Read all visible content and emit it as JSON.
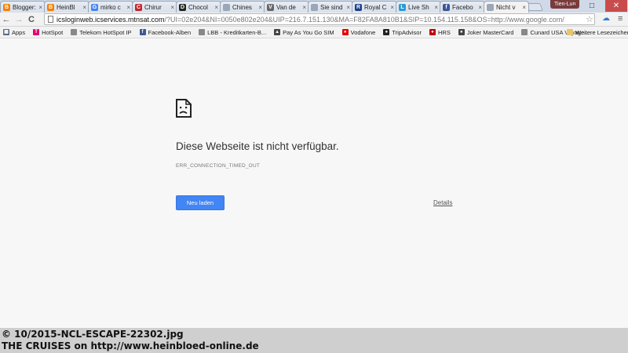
{
  "tabs": [
    {
      "label": "Blogger:",
      "icon": "B",
      "color": "#f57d00"
    },
    {
      "label": "HeinBl",
      "icon": "B",
      "color": "#f57d00"
    },
    {
      "label": "mirko c",
      "icon": "G",
      "color": "#4285f4"
    },
    {
      "label": "Chirur",
      "icon": "C",
      "color": "#c1272d"
    },
    {
      "label": "Chocol",
      "icon": "D",
      "color": "#222222"
    },
    {
      "label": "Chines",
      "icon": "",
      "color": "#9aa7b8"
    },
    {
      "label": "Van de",
      "icon": "V",
      "color": "#666666"
    },
    {
      "label": "Sie sind",
      "icon": "",
      "color": "#9aa7b8"
    },
    {
      "label": "Royal C",
      "icon": "R",
      "color": "#1b3f8b"
    },
    {
      "label": "Live Sh",
      "icon": "L",
      "color": "#2a9ad6"
    },
    {
      "label": "Facebo",
      "icon": "f",
      "color": "#3b5998"
    },
    {
      "label": "Nicht v",
      "icon": "",
      "color": "#9aa7b8"
    }
  ],
  "profile_name": "Tien-Lun",
  "window_controls": {
    "minimize": "–",
    "maximize": "□",
    "close": "✕"
  },
  "toolbar": {
    "back": "←",
    "forward": "→",
    "reload": "C"
  },
  "url": {
    "host": "icsloginweb.icservices.mtnsat.com",
    "rest": "/?UI=02e204&NI=0050e802e204&UIP=216.7.151.130&MA=F82FA8A810B1&SIP=10.154.115.158&OS=http://www.google.com/"
  },
  "bookmarks": [
    {
      "label": "Apps",
      "icon": "▦",
      "color": "#5a6b86"
    },
    {
      "label": "HotSpot",
      "icon": "T",
      "color": "#e20074"
    },
    {
      "label": "Telekom HotSpot IP",
      "icon": "",
      "color": "#888888"
    },
    {
      "label": "Facebook-Alben",
      "icon": "f",
      "color": "#3b5998"
    },
    {
      "label": "LBB - Kreditkarten-B...",
      "icon": "",
      "color": "#888888"
    },
    {
      "label": "Pay As You Go SIM",
      "icon": "▲",
      "color": "#444444"
    },
    {
      "label": "Vodafone",
      "icon": "●",
      "color": "#e60000"
    },
    {
      "label": "TripAdvisor",
      "icon": "●",
      "color": "#222222"
    },
    {
      "label": "HRS",
      "icon": "●",
      "color": "#c00000"
    },
    {
      "label": "Joker MasterCard",
      "icon": "●",
      "color": "#444444"
    },
    {
      "label": "Cunard USA Voyage...",
      "icon": "",
      "color": "#888888"
    }
  ],
  "other_bookmarks": "Weitere Lesezeichen",
  "error": {
    "title": "Diese Webseite ist nicht verfügbar.",
    "code": "ERR_CONNECTION_TIMED_OUT",
    "reload_label": "Neu laden",
    "details_label": "Details"
  },
  "caption": {
    "line1": "© 10/2015-NCL-ESCAPE-22302.jpg",
    "line2": "THE CRUISES on http://www.heinbloed-online.de"
  }
}
